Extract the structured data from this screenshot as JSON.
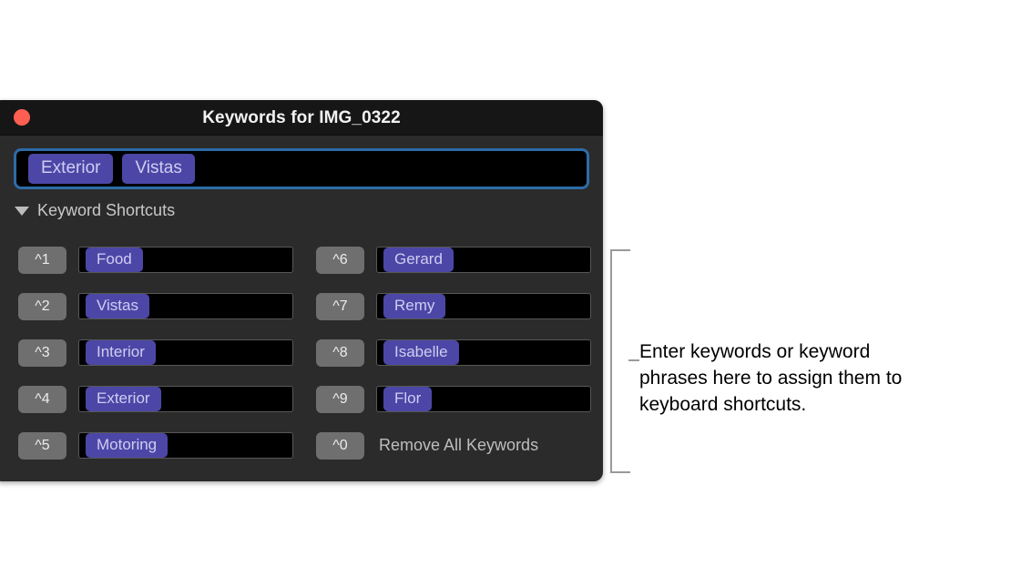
{
  "window": {
    "title": "Keywords for IMG_0322",
    "close_icon": "close-icon",
    "accent_focus_color": "#2c6ca8",
    "token_color": "#4c47a6",
    "token_text_color": "#cfcdf2",
    "key_badge_color": "#6f6f6f",
    "titlebar_color": "#161616",
    "body_color": "#2b2b2b",
    "close_button_color": "#ff5f52"
  },
  "keyword_field": {
    "tokens": [
      "Exterior",
      "Vistas"
    ]
  },
  "shortcuts_section": {
    "disclosure_icon": "triangle-down-icon",
    "title": "Keyword Shortcuts"
  },
  "shortcuts": {
    "left": [
      {
        "key": "^1",
        "keyword": "Food"
      },
      {
        "key": "^2",
        "keyword": "Vistas"
      },
      {
        "key": "^3",
        "keyword": "Interior"
      },
      {
        "key": "^4",
        "keyword": "Exterior"
      },
      {
        "key": "^5",
        "keyword": "Motoring"
      }
    ],
    "right": [
      {
        "key": "^6",
        "keyword": "Gerard"
      },
      {
        "key": "^7",
        "keyword": "Remy"
      },
      {
        "key": "^8",
        "keyword": "Isabelle"
      },
      {
        "key": "^9",
        "keyword": "Flor"
      },
      {
        "key": "^0",
        "label": "Remove All Keywords"
      }
    ]
  },
  "annotation": {
    "text": "Enter keywords or keyword phrases here to assign them to keyboard shortcuts.",
    "line_color": "#9a9a9a"
  }
}
